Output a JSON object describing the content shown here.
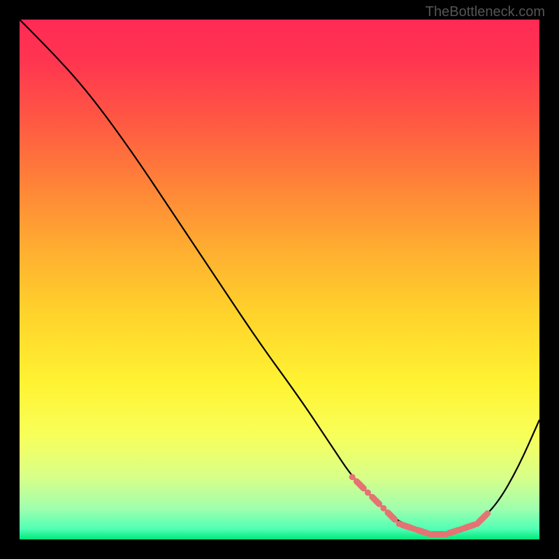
{
  "watermark": "TheBottleneck.com",
  "chart_data": {
    "type": "line",
    "title": "",
    "xlabel": "",
    "ylabel": "",
    "xlim": [
      0,
      100
    ],
    "ylim": [
      0,
      100
    ],
    "grid": false,
    "series": [
      {
        "name": "curve",
        "color": "#000000",
        "x": [
          0,
          7,
          14,
          22,
          30,
          38,
          46,
          54,
          60,
          64,
          68,
          72,
          76,
          80,
          84,
          88,
          92,
          96,
          100
        ],
        "y": [
          100,
          93,
          85,
          74,
          62,
          50,
          38,
          27,
          18,
          12,
          8,
          4,
          2,
          1,
          1,
          3,
          7,
          14,
          23
        ]
      },
      {
        "name": "flat-region-markers",
        "color": "#e57373",
        "type": "scatter",
        "x": [
          64,
          67,
          70,
          73,
          76,
          79,
          82,
          85,
          88,
          90
        ],
        "y": [
          12,
          9,
          6,
          3,
          2,
          1,
          1,
          2,
          3,
          5
        ]
      }
    ],
    "gradient_stops": [
      {
        "pos": 0,
        "color": "#ff2a55"
      },
      {
        "pos": 0.5,
        "color": "#ffd42b"
      },
      {
        "pos": 0.85,
        "color": "#f8ff5a"
      },
      {
        "pos": 1.0,
        "color": "#00e87a"
      }
    ]
  }
}
